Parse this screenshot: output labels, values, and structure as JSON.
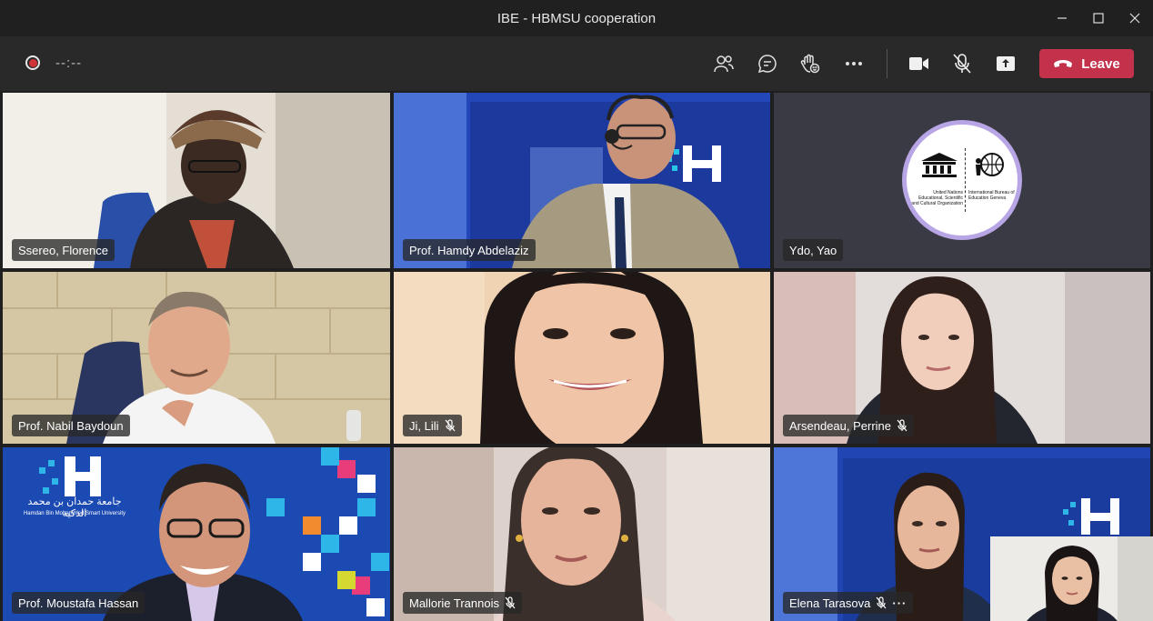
{
  "window": {
    "title": "IBE - HBMSU cooperation",
    "minimize": "—",
    "maximize": "☐",
    "close": "✕"
  },
  "toolbar": {
    "timer": "--:--",
    "leave_label": "Leave",
    "icons": [
      "participants-icon",
      "chat-icon",
      "raise-hand-icon",
      "more-options-icon",
      "camera-icon",
      "mic-off-icon",
      "share-screen-icon",
      "phone-hangup-icon"
    ]
  },
  "tiles": [
    {
      "name": "Ssereo, Florence",
      "muted": false
    },
    {
      "name": "Prof. Hamdy Abdelaziz",
      "muted": false
    },
    {
      "name": "Ydo, Yao",
      "muted": false
    },
    {
      "name": "Prof. Nabil Baydoun",
      "muted": false
    },
    {
      "name": "Ji, Lili",
      "muted": true
    },
    {
      "name": "Arsendeau, Perrine",
      "muted": true
    },
    {
      "name": "Prof. Moustafa Hassan",
      "muted": false
    },
    {
      "name": "Mallorie Trannois",
      "muted": true
    },
    {
      "name": "Elena Tarasova",
      "muted": true,
      "more": "···"
    }
  ],
  "unesco_logo": {
    "left_text": "United Nations Educational, Scientific and Cultural Organization",
    "right_text": "International Bureau of Education Geneva"
  },
  "hbmsu_logo": {
    "arabic": "جامعة حمدان بن محمد الذكية",
    "english": "Hamdan Bin Mohammed Smart University"
  },
  "colors": {
    "leave": "#c4314b",
    "record": "#d13438",
    "hbmsu_blue": "#1f4fbf",
    "unesco_ring": "#b8a5e6"
  }
}
